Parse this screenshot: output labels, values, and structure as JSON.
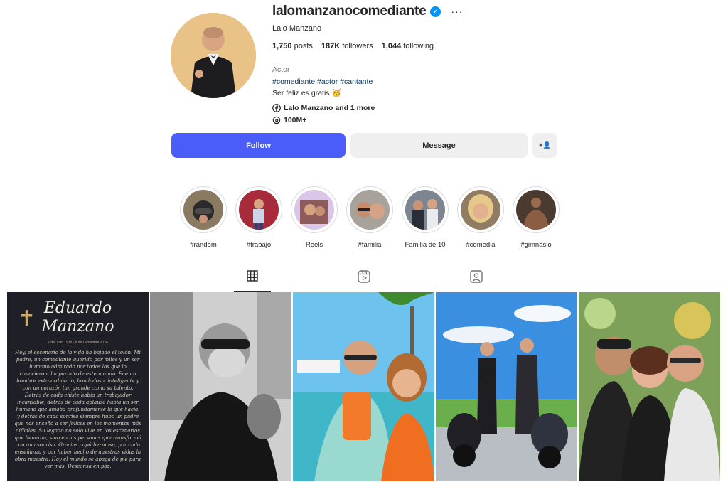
{
  "profile": {
    "username": "lalomanzanocomediante",
    "verified_glyph": "✓",
    "more_glyph": "···",
    "full_name": "Lalo Manzano",
    "posts_count": "1,750",
    "posts_label": "posts",
    "followers_count": "187K",
    "followers_label": "followers",
    "following_count": "1,044",
    "following_label": "following",
    "category": "Actor",
    "hashtags": [
      "#comediante",
      "#actor",
      "#cantante"
    ],
    "bio": "Ser feliz es gratis 🥳",
    "facebook_link": "Lalo Manzano and 1 more",
    "threads_count": "100M+"
  },
  "actions": {
    "follow": "Follow",
    "message": "Message",
    "add_user_glyph": "+👤"
  },
  "highlights": [
    {
      "label": "#random"
    },
    {
      "label": "#trabajo"
    },
    {
      "label": "Reels"
    },
    {
      "label": "#familia"
    },
    {
      "label": "Familia de 10"
    },
    {
      "label": "#comedia"
    },
    {
      "label": "#gimnasio"
    }
  ],
  "tabs": [
    {
      "name": "posts",
      "icon": "grid-icon",
      "active": true
    },
    {
      "name": "reels",
      "icon": "reels-icon",
      "active": false
    },
    {
      "name": "tagged",
      "icon": "tagged-icon",
      "active": false
    }
  ],
  "posts": [
    {
      "type": "memorial",
      "title_line1": "Eduardo",
      "title_line2": "Manzano",
      "date": "7 de Julio 1938 - 6 de Diciembre 2024",
      "text": "Hoy, el escenario de la vida ha bajado el telón. Mi padre, un comediante querido por miles y un ser humano admirado por todos los que lo conocieron, ha partido de este mundo. Fue un hombre extraordinario, bondadoso, inteligente y con un corazón tan grande como su talento. Detrás de cada chiste había un trabajador incansable, detrás de cada aplauso había un ser humano que amaba profundamente lo que hacía, y detrás de cada sonrisa siempre hubo un padre que nos enseñó a ser felices en los momentos más difíciles. Su legado no solo vive en los escenarios que llenaron, sino en las personas que transformó con una sonrisa. Gracias papá hermoso, por cada enseñanza y por haber hecho de nuestras vidas la obra maestra. Hoy el mundo se apaga de pie para ver más. Descansa en paz."
    },
    {
      "type": "photo",
      "subject": "bw-gym-portrait"
    },
    {
      "type": "photo",
      "subject": "beach-selfie"
    },
    {
      "type": "photo",
      "subject": "motorcycles-track"
    },
    {
      "type": "photo",
      "subject": "family-hug"
    }
  ],
  "colors": {
    "follow_bg": "#4a5df9",
    "verified": "#0095f6",
    "hashtag": "#00376b"
  }
}
